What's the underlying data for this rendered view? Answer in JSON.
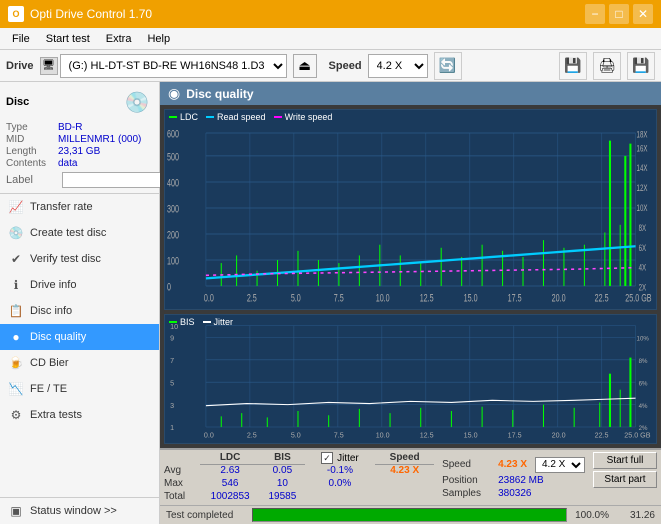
{
  "titlebar": {
    "title": "Opti Drive Control 1.70",
    "minimize": "−",
    "maximize": "□",
    "close": "✕"
  },
  "menu": {
    "items": [
      "File",
      "Start test",
      "Extra",
      "Help"
    ]
  },
  "toolbar": {
    "drive_label": "Drive",
    "drive_value": "(G:) HL-DT-ST BD-RE  WH16NS48 1.D3",
    "speed_label": "Speed",
    "speed_value": "4.2 X"
  },
  "disc": {
    "section_title": "Disc",
    "type_label": "Type",
    "type_value": "BD-R",
    "mid_label": "MID",
    "mid_value": "MILLENMR1 (000)",
    "length_label": "Length",
    "length_value": "23,31 GB",
    "contents_label": "Contents",
    "contents_value": "data",
    "label_label": "Label",
    "label_value": ""
  },
  "sidebar_nav": [
    {
      "id": "transfer-rate",
      "label": "Transfer rate",
      "icon": "📈"
    },
    {
      "id": "create-test-disc",
      "label": "Create test disc",
      "icon": "💿"
    },
    {
      "id": "verify-test-disc",
      "label": "Verify test disc",
      "icon": "✔"
    },
    {
      "id": "drive-info",
      "label": "Drive info",
      "icon": "ℹ"
    },
    {
      "id": "disc-info",
      "label": "Disc info",
      "icon": "📋"
    },
    {
      "id": "disc-quality",
      "label": "Disc quality",
      "icon": "🔵",
      "active": true
    },
    {
      "id": "cd-bier",
      "label": "CD Bier",
      "icon": "🍺"
    },
    {
      "id": "fe-te",
      "label": "FE / TE",
      "icon": "📉"
    },
    {
      "id": "extra-tests",
      "label": "Extra tests",
      "icon": "⚙"
    }
  ],
  "status_window": "Status window >>",
  "chart": {
    "title": "Disc quality",
    "legend_top": [
      {
        "label": "LDC",
        "color": "#00ff00"
      },
      {
        "label": "Read speed",
        "color": "#00ccff"
      },
      {
        "label": "Write speed",
        "color": "#ff00ff"
      }
    ],
    "legend_bottom": [
      {
        "label": "BIS",
        "color": "#00ff00"
      },
      {
        "label": "Jitter",
        "color": "#ffffff"
      }
    ],
    "top_y_max": "600",
    "top_y_labels": [
      "600",
      "500",
      "400",
      "300",
      "200",
      "100",
      "0"
    ],
    "top_y_right": [
      "18X",
      "16X",
      "14X",
      "12X",
      "10X",
      "8X",
      "6X",
      "4X",
      "2X"
    ],
    "bottom_y_max": "10",
    "x_labels": [
      "0.0",
      "2.5",
      "5.0",
      "7.5",
      "10.0",
      "12.5",
      "15.0",
      "17.5",
      "20.0",
      "22.5",
      "25.0 GB"
    ]
  },
  "stats": {
    "columns": [
      "LDC",
      "BIS",
      "",
      "Jitter",
      "Speed"
    ],
    "avg_label": "Avg",
    "avg_ldc": "2.63",
    "avg_bis": "0.05",
    "avg_jitter": "-0.1%",
    "max_label": "Max",
    "max_ldc": "546",
    "max_bis": "10",
    "max_jitter": "0.0%",
    "total_label": "Total",
    "total_ldc": "1002853",
    "total_bis": "19585",
    "speed_label": "Speed",
    "speed_value": "4.23 X",
    "position_label": "Position",
    "position_value": "23862 MB",
    "samples_label": "Samples",
    "samples_value": "380326",
    "speed_dropdown": "4.2 X",
    "start_full": "Start full",
    "start_part": "Start part"
  },
  "progress": {
    "status": "Test completed",
    "percent": 100,
    "percent_display": "100.0%",
    "value": "31.26"
  }
}
